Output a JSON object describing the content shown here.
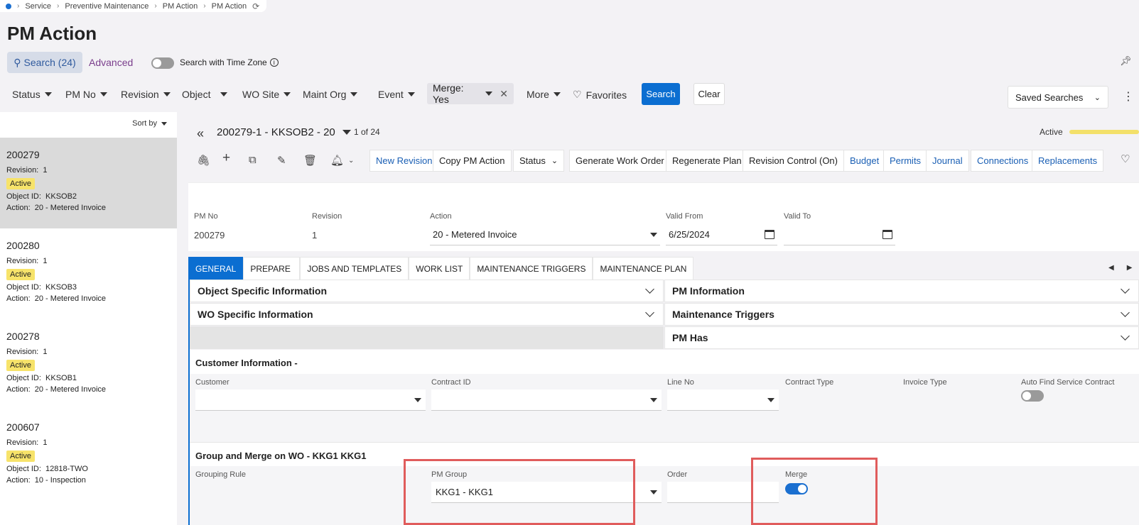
{
  "breadcrumb": [
    "Service",
    "Preventive Maintenance",
    "PM Action",
    "PM Action"
  ],
  "page_title": "PM Action",
  "search": {
    "label": "Search (24)",
    "advanced": "Advanced",
    "timezone_label": "Search with Time Zone"
  },
  "filters": [
    "Status",
    "PM No",
    "Revision",
    "Object",
    "WO Site",
    "Maint Org",
    "Event"
  ],
  "merge_chip": "Merge: Yes",
  "more": "More",
  "favorites": "Favorites",
  "search_button": "Search",
  "clear_button": "Clear",
  "saved_searches": "Saved Searches",
  "sort_by": "Sort by",
  "list": [
    {
      "id": "200279",
      "revision_label": "Revision:",
      "revision": "1",
      "status": "Active",
      "object_label": "Object ID:",
      "object": "KKSOB2",
      "action_label": "Action:",
      "action": "20 - Metered Invoice"
    },
    {
      "id": "200280",
      "revision_label": "Revision:",
      "revision": "1",
      "status": "Active",
      "object_label": "Object ID:",
      "object": "KKSOB3",
      "action_label": "Action:",
      "action": "20 - Metered Invoice"
    },
    {
      "id": "200278",
      "revision_label": "Revision:",
      "revision": "1",
      "status": "Active",
      "object_label": "Object ID:",
      "object": "KKSOB1",
      "action_label": "Action:",
      "action": "20 - Metered Invoice"
    },
    {
      "id": "200607",
      "revision_label": "Revision:",
      "revision": "1",
      "status": "Active",
      "object_label": "Object ID:",
      "object": "12818-TWO",
      "action_label": "Action:",
      "action": "10 - Inspection"
    }
  ],
  "record": {
    "title": "200279-1 - KKSOB2 - 20",
    "counter": "1 of 24",
    "state": "Active"
  },
  "toolbar": {
    "new_revision": "New Revision",
    "copy_pm_action": "Copy PM Action",
    "status": "Status",
    "generate_wo": "Generate Work Order",
    "regenerate_plan": "Regenerate Plan",
    "revision_control": "Revision Control (On)",
    "budget": "Budget",
    "permits": "Permits",
    "journal": "Journal",
    "connections": "Connections",
    "replacements": "Replacements"
  },
  "header_form": {
    "pm_no_label": "PM No",
    "pm_no": "200279",
    "revision_label": "Revision",
    "revision": "1",
    "action_label": "Action",
    "action": "20 - Metered Invoice",
    "valid_from_label": "Valid From",
    "valid_from": "6/25/2024",
    "valid_to_label": "Valid To",
    "valid_to": ""
  },
  "tabs": [
    "GENERAL",
    "PREPARE",
    "JOBS AND TEMPLATES",
    "WORK LIST",
    "MAINTENANCE TRIGGERS",
    "MAINTENANCE PLAN"
  ],
  "sections": {
    "object_specific": "Object Specific Information",
    "pm_information": "PM Information",
    "wo_specific": "WO Specific Information",
    "maintenance_triggers": "Maintenance Triggers",
    "pm_has": "PM Has"
  },
  "customer_info": {
    "title": "Customer Information -",
    "customer_label": "Customer",
    "contract_id_label": "Contract ID",
    "line_no_label": "Line No",
    "contract_type_label": "Contract Type",
    "invoice_type_label": "Invoice Type",
    "auto_find_label": "Auto Find Service Contract"
  },
  "group_merge": {
    "title": "Group and Merge on WO - KKG1 KKG1",
    "grouping_rule_label": "Grouping Rule",
    "pm_group_label": "PM Group",
    "pm_group": "KKG1 - KKG1",
    "order_label": "Order",
    "merge_label": "Merge"
  }
}
